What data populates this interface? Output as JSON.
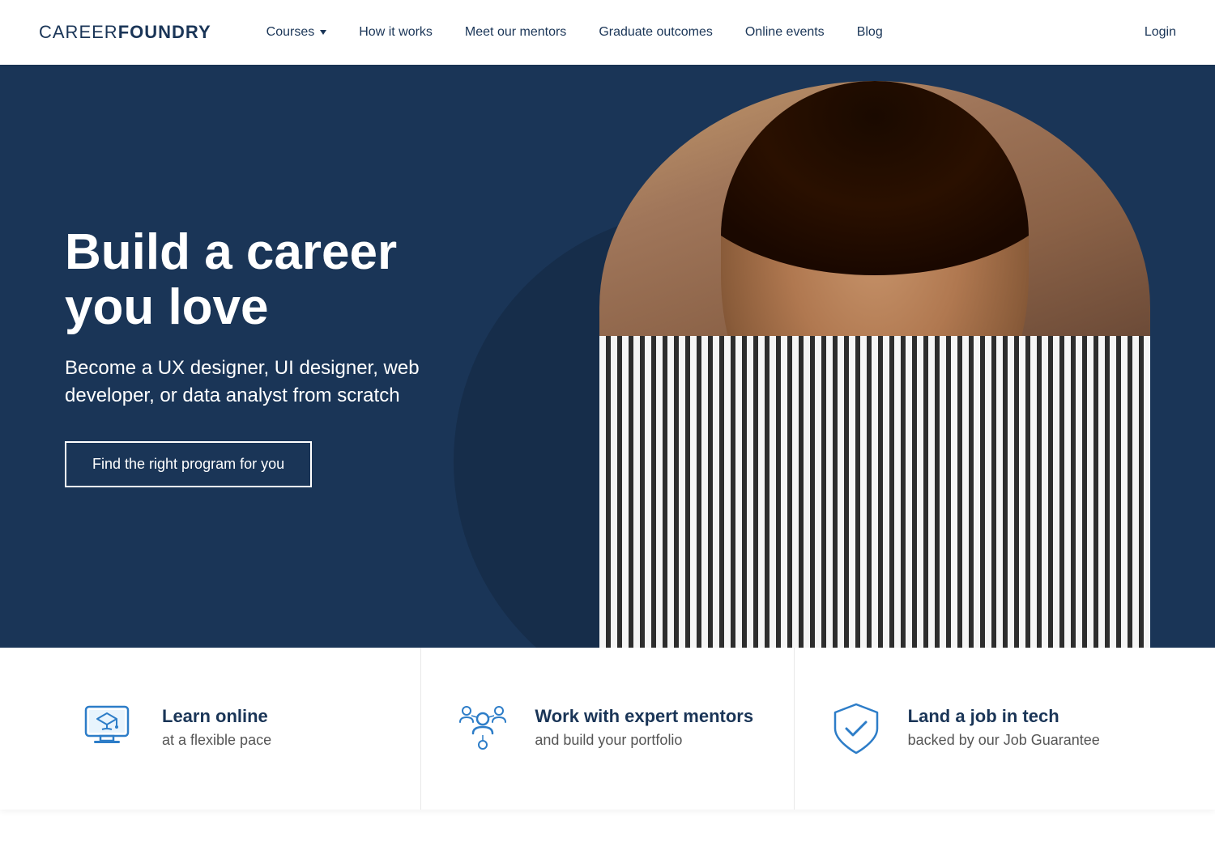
{
  "nav": {
    "logo_career": "CAREER",
    "logo_foundry": "FOUNDRY",
    "courses_label": "Courses",
    "how_it_works_label": "How it works",
    "mentors_label": "Meet our mentors",
    "outcomes_label": "Graduate outcomes",
    "events_label": "Online events",
    "blog_label": "Blog",
    "login_label": "Login"
  },
  "hero": {
    "title": "Build a career you love",
    "subtitle": "Become a UX designer, UI designer, web developer, or data analyst from scratch",
    "cta_label": "Find the right program for you"
  },
  "features": [
    {
      "icon": "monitor-graduation",
      "title": "Learn online",
      "desc": "at a flexible pace"
    },
    {
      "icon": "people-network",
      "title": "Work with expert mentors",
      "desc": "and build your portfolio"
    },
    {
      "icon": "shield-check",
      "title": "Land a job in tech",
      "desc": "backed by our Job Guarantee"
    }
  ],
  "colors": {
    "primary_dark": "#1a3557",
    "white": "#ffffff",
    "accent_blue": "#2d7dc8"
  }
}
